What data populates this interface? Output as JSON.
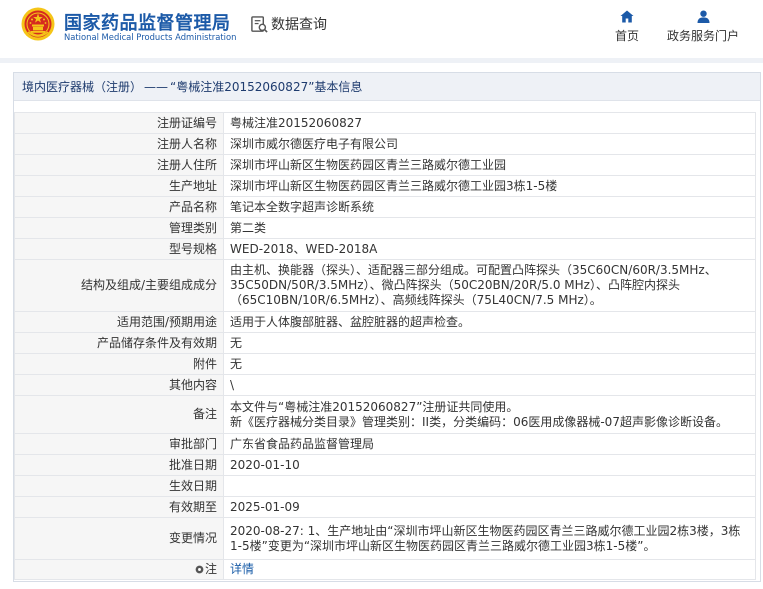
{
  "header": {
    "brand_cn": "国家药品监督管理局",
    "brand_en": "National Medical Products Administration",
    "data_query": "数据查询",
    "nav_home": "首页",
    "nav_portal": "政务服务门户"
  },
  "breadcrumb": {
    "category": "境内医疗器械（注册）",
    "separator": "——",
    "title": "“粤械注准20152060827”基本信息"
  },
  "rows": [
    {
      "label": "注册证编号",
      "value": "粤械注准20152060827"
    },
    {
      "label": "注册人名称",
      "value": "深圳市威尔德医疗电子有限公司"
    },
    {
      "label": "注册人住所",
      "value": "深圳市坪山新区生物医药园区青兰三路威尔德工业园"
    },
    {
      "label": "生产地址",
      "value": "深圳市坪山新区生物医药园区青兰三路威尔德工业园3栋1-5楼"
    },
    {
      "label": "产品名称",
      "value": "笔记本全数字超声诊断系统"
    },
    {
      "label": "管理类别",
      "value": "第二类"
    },
    {
      "label": "型号规格",
      "value": "WED-2018、WED-2018A"
    },
    {
      "label": "结构及组成/主要组成成分",
      "value": "由主机、换能器（探头）、适配器三部分组成。可配置凸阵探头（35C60CN/60R/3.5MHz、35C50DN/50R/3.5MHz）、微凸阵探头（50C20BN/20R/5.0 MHz）、凸阵腔内探头（65C10BN/10R/6.5MHz）、高频线阵探头（75L40CN/7.5 MHz）。"
    },
    {
      "label": "适用范围/预期用途",
      "value": "适用于人体腹部脏器、盆腔脏器的超声检查。"
    },
    {
      "label": "产品储存条件及有效期",
      "value": "无"
    },
    {
      "label": "附件",
      "value": "无"
    },
    {
      "label": "其他内容",
      "value": "\\"
    },
    {
      "label": "备注",
      "value": "本文件与“粤械注准20152060827”注册证共同使用。",
      "value2": "新《医疗器械分类目录》管理类别：II类，分类编码：06医用成像器械-07超声影像诊断设备。"
    },
    {
      "label": "审批部门",
      "value": "广东省食品药品监督管理局"
    },
    {
      "label": "批准日期",
      "value": "2020-01-10"
    },
    {
      "label": "生效日期",
      "value": ""
    },
    {
      "label": "有效期至",
      "value": "2025-01-09"
    },
    {
      "label": "变更情况",
      "value": "2020-08-27: 1、生产地址由“深圳市坪山新区生物医药园区青兰三路威尔德工业园2栋3楼，3栋1-5楼”变更为“深圳市坪山新区生物医药园区青兰三路威尔德工业园3栋1-5楼”。"
    },
    {
      "label": "注",
      "value": "详情"
    }
  ],
  "colors": {
    "brand_blue": "#1c5aa8",
    "link_blue": "#1a5da8",
    "label_bg": "#f6f6f6",
    "header_bar_bg": "#eef1f6",
    "emblem_red": "#d62b1f",
    "emblem_gold": "#f5c518"
  },
  "icons": [
    "national-emblem-icon",
    "data-query-icon",
    "home-icon",
    "user-icon",
    "pin-icon"
  ]
}
